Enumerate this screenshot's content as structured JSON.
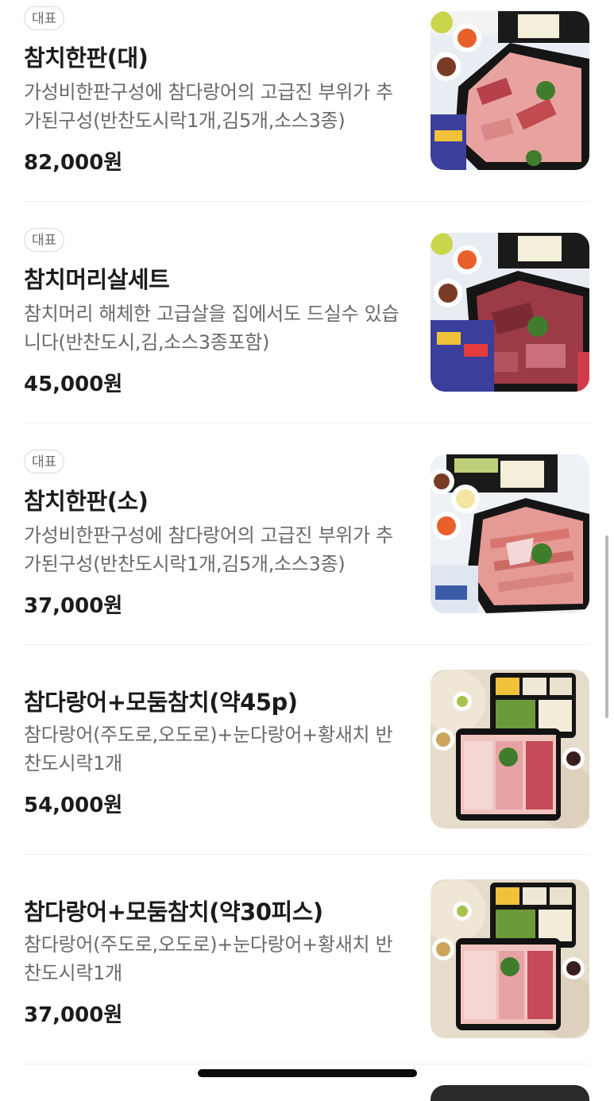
{
  "menu": {
    "items": [
      {
        "badge": "대표",
        "name": "참치한판(대)",
        "description": "가성비한판구성에 참다랑어의 고급진 부위가 추가된구성(반찬도시락1개,김5개,소스3종)",
        "price": "82,000원",
        "image_icon": "tuna-platter-large-photo"
      },
      {
        "badge": "대표",
        "name": "참치머리살세트",
        "description": "참치머리 해체한 고급살을 집에서도 드실수 있습니다(반찬도시,김,소스3종포함)",
        "price": "45,000원",
        "image_icon": "tuna-head-meat-photo"
      },
      {
        "badge": "대표",
        "name": "참치한판(소)",
        "description": "가성비한판구성에 참다랑어의 고급진 부위가 추가된구성(반찬도시락1개,김5개,소스3종)",
        "price": "37,000원",
        "image_icon": "tuna-platter-small-photo"
      },
      {
        "badge": "",
        "name": "참다랑어+모둠참치(약45p)",
        "description": "참다랑어(주도로,오도로)+눈다랑어+황새치 반찬도시락1개",
        "price": "54,000원",
        "image_icon": "bluefin-assorted-45-photo"
      },
      {
        "badge": "",
        "name": "참다랑어+모둠참치(약30피스)",
        "description": "참다랑어(주도로,오도로)+눈다랑어+황새치 반찬도시락1개",
        "price": "37,000원",
        "image_icon": "bluefin-assorted-30-photo"
      }
    ]
  },
  "colors": {
    "text_primary": "#1b1b1b",
    "text_secondary": "#6a6a6a",
    "badge_border": "#d9d9d9",
    "divider": "#eeeeee",
    "tray_black": "#161616",
    "tuna_red": "#b8424a",
    "tuna_pink": "#e9a8a6",
    "garnish_green": "#3f7d2c"
  }
}
